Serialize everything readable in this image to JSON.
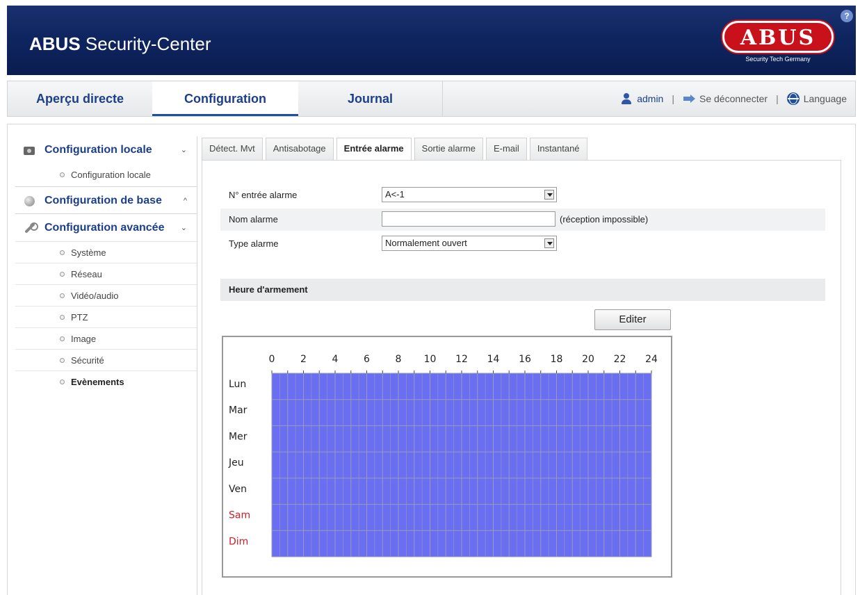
{
  "header": {
    "title_bold": "ABUS",
    "title_rest": "Security-Center",
    "logo_text": "ABUS",
    "logo_tagline": "Security Tech Germany",
    "help_label": "?"
  },
  "nav": {
    "tabs": [
      {
        "label": "Aperçu directe"
      },
      {
        "label": "Configuration"
      },
      {
        "label": "Journal"
      }
    ],
    "user": "admin",
    "logout": "Se déconnecter",
    "language": "Language",
    "separator": "|"
  },
  "sidebar": {
    "local": {
      "label": "Configuration locale",
      "chevron": "⌄",
      "items": [
        {
          "label": "Configuration locale"
        }
      ]
    },
    "base": {
      "label": "Configuration de base",
      "chevron": "^"
    },
    "advanced": {
      "label": "Configuration avancée",
      "chevron": "⌄",
      "items": [
        {
          "label": "Système"
        },
        {
          "label": "Réseau"
        },
        {
          "label": "Vidéo/audio"
        },
        {
          "label": "PTZ"
        },
        {
          "label": "Image"
        },
        {
          "label": "Sécurité"
        },
        {
          "label": "Evènements"
        }
      ]
    }
  },
  "content_tabs": [
    {
      "label": "Détect. Mvt"
    },
    {
      "label": "Antisabotage"
    },
    {
      "label": "Entrée alarme"
    },
    {
      "label": "Sortie alarme"
    },
    {
      "label": "E-mail"
    },
    {
      "label": "Instantané"
    }
  ],
  "form": {
    "input_no_label": "N° entrée alarme",
    "input_no_value": "A<-1",
    "name_label": "Nom alarme",
    "name_value": "",
    "name_hint": "(réception impossible)",
    "type_label": "Type alarme",
    "type_value": "Normalement ouvert"
  },
  "schedule": {
    "section_title": "Heure d'armement",
    "edit_label": "Editer",
    "hour_ticks": [
      "0",
      "2",
      "4",
      "6",
      "8",
      "10",
      "12",
      "14",
      "16",
      "18",
      "20",
      "22",
      "24"
    ],
    "days": [
      {
        "label": "Lun",
        "weekend": false
      },
      {
        "label": "Mar",
        "weekend": false
      },
      {
        "label": "Mer",
        "weekend": false
      },
      {
        "label": "Jeu",
        "weekend": false
      },
      {
        "label": "Ven",
        "weekend": false
      },
      {
        "label": "Sam",
        "weekend": true
      },
      {
        "label": "Dim",
        "weekend": true
      }
    ],
    "armed_hours": [
      0,
      24
    ],
    "fill_color": "#6a6ff2",
    "grid_color": "#9a9ab8",
    "weekend_color": "#c8202a"
  }
}
